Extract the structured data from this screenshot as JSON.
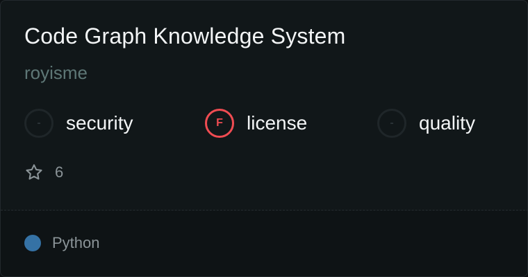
{
  "repo": {
    "title": "Code Graph Knowledge System",
    "owner": "royisme"
  },
  "badges": [
    {
      "name": "security",
      "grade": "-",
      "status": "none"
    },
    {
      "name": "license",
      "grade": "F",
      "status": "fail"
    },
    {
      "name": "quality",
      "grade": "-",
      "status": "none"
    }
  ],
  "stars": {
    "count": "6",
    "icon": "star-outline-icon"
  },
  "language": {
    "name": "Python",
    "color": "#3572a5"
  },
  "colors": {
    "fail": "#f04c52",
    "neutral": "#1f2629"
  }
}
